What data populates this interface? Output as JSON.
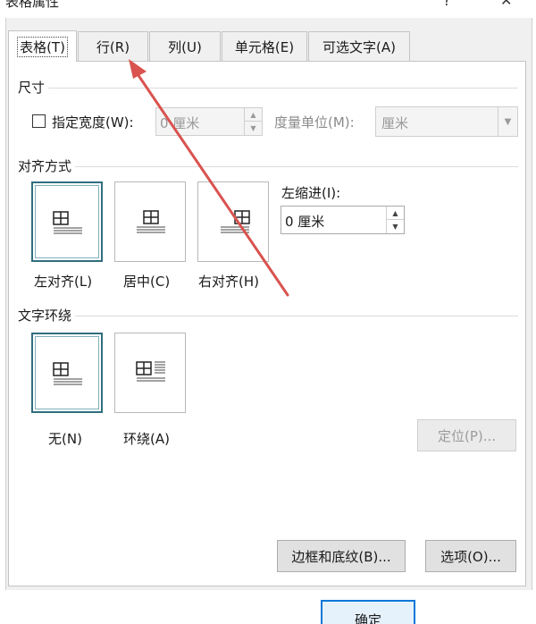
{
  "window": {
    "title": "表格属性",
    "help_glyph": "?",
    "close_glyph": "✕"
  },
  "tabs": [
    {
      "label": "表格(T)",
      "active": true
    },
    {
      "label": "行(R)",
      "active": false
    },
    {
      "label": "列(U)",
      "active": false
    },
    {
      "label": "单元格(E)",
      "active": false
    },
    {
      "label": "可选文字(A)",
      "active": false
    }
  ],
  "size": {
    "section_label": "尺寸",
    "specify_width_label": "指定宽度(W):",
    "specify_width_checked": false,
    "width_value": "0 厘米",
    "measure_label": "度量单位(M):",
    "measure_value": "厘米"
  },
  "alignment": {
    "section_label": "对齐方式",
    "options": [
      {
        "label": "左对齐(L)",
        "selected": true
      },
      {
        "label": "居中(C)",
        "selected": false
      },
      {
        "label": "右对齐(H)",
        "selected": false
      }
    ],
    "indent_label": "左缩进(I):",
    "indent_value": "0 厘米"
  },
  "wrapping": {
    "section_label": "文字环绕",
    "options": [
      {
        "label": "无(N)",
        "selected": true
      },
      {
        "label": "环绕(A)",
        "selected": false
      }
    ],
    "position_button": "定位(P)..."
  },
  "footer": {
    "borders_button": "边框和底纹(B)...",
    "options_button": "选项(O)...",
    "ok_button": "确定"
  },
  "colors": {
    "annotation_arrow": "#d9534f",
    "selected_border": "#2f6f7e",
    "ok_border": "#0078d7"
  }
}
